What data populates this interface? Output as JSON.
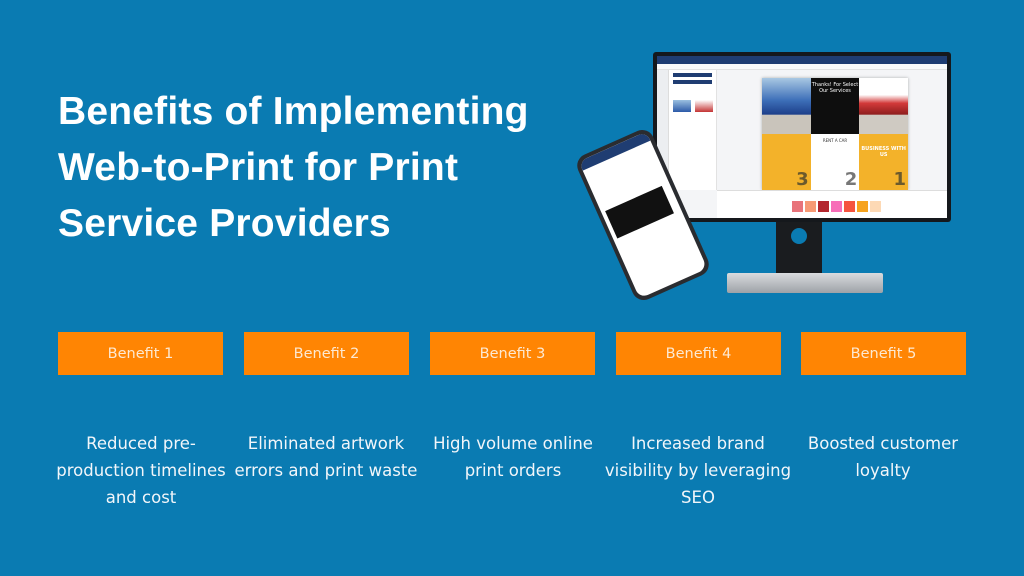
{
  "title": "Benefits of Implementing Web-to-Print for Print Service Providers",
  "colors": {
    "background": "#0a7bb2",
    "benefit_box": "#ff8503",
    "text": "#ffffff"
  },
  "benefits": [
    {
      "label": "Benefit 1",
      "description": "Reduced pre-production timelines and cost"
    },
    {
      "label": "Benefit 2",
      "description": "Eliminated artwork errors and print waste"
    },
    {
      "label": "Benefit 3",
      "description": "High volume online print orders"
    },
    {
      "label": "Benefit 4",
      "description": "Increased brand visibility by leveraging SEO"
    },
    {
      "label": "Benefit 5",
      "description": "Boosted customer loyalty"
    }
  ],
  "illustration": {
    "flyer_heading": "Thanks! For Select Our Services",
    "flyer_brand": "RENT A CAR",
    "flyer_tagline": "BUSINESS WITH US",
    "panel_numbers": [
      "3",
      "2",
      "1"
    ],
    "swatch_colors": [
      "#e8737a",
      "#f79a74",
      "#b3262e",
      "#f76db8",
      "#f5543f",
      "#f6a31e",
      "#fdd9b5"
    ]
  }
}
